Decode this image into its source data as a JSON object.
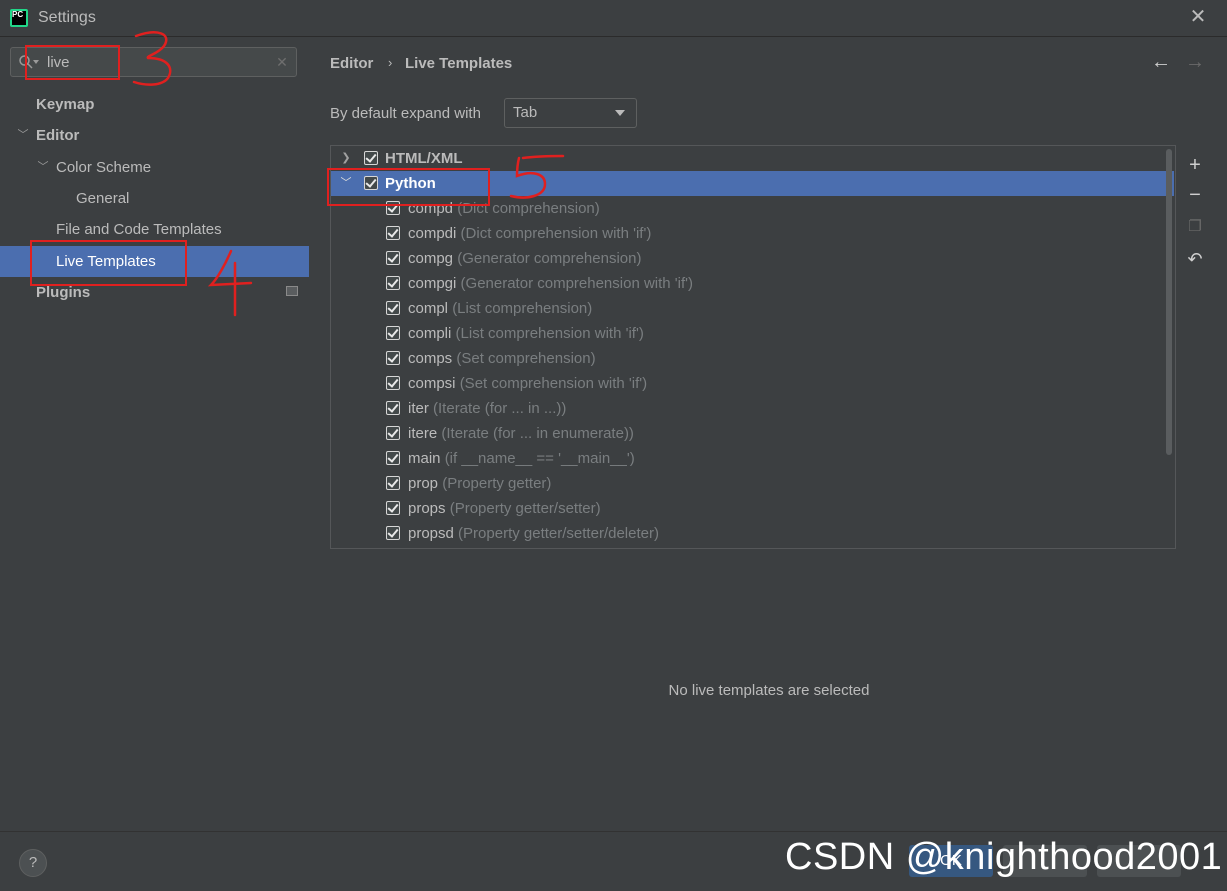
{
  "window": {
    "title": "Settings",
    "app_icon": "pycharm-icon",
    "app_icon_text": "PC"
  },
  "search": {
    "value": "live",
    "placeholder": ""
  },
  "sidebar": {
    "items": [
      {
        "label": "Keymap"
      },
      {
        "label": "Editor"
      },
      {
        "label": "Color Scheme"
      },
      {
        "label": "General"
      },
      {
        "label": "File and Code Templates"
      },
      {
        "label": "Live Templates"
      },
      {
        "label": "Plugins"
      }
    ],
    "selected": "Live Templates"
  },
  "breadcrumb": {
    "parent": "Editor",
    "separator": "›",
    "current": "Live Templates"
  },
  "expand": {
    "label": "By default expand with",
    "value": "Tab"
  },
  "groups": [
    {
      "name": "HTML/XML",
      "expanded": false,
      "checked": true
    },
    {
      "name": "Python",
      "expanded": true,
      "checked": true,
      "selected": true
    }
  ],
  "templates": [
    {
      "abbr": "compd",
      "desc": "(Dict comprehension)"
    },
    {
      "abbr": "compdi",
      "desc": "(Dict comprehension with 'if')"
    },
    {
      "abbr": "compg",
      "desc": "(Generator comprehension)"
    },
    {
      "abbr": "compgi",
      "desc": "(Generator comprehension with 'if')"
    },
    {
      "abbr": "compl",
      "desc": "(List comprehension)"
    },
    {
      "abbr": "compli",
      "desc": "(List comprehension with 'if')"
    },
    {
      "abbr": "comps",
      "desc": "(Set comprehension)"
    },
    {
      "abbr": "compsi",
      "desc": "(Set comprehension with 'if')"
    },
    {
      "abbr": "iter",
      "desc": "(Iterate (for ... in ...))"
    },
    {
      "abbr": "itere",
      "desc": "(Iterate (for ... in enumerate))"
    },
    {
      "abbr": "main",
      "desc": "(if __name__ == '__main__')"
    },
    {
      "abbr": "prop",
      "desc": "(Property getter)"
    },
    {
      "abbr": "props",
      "desc": "(Property getter/setter)"
    },
    {
      "abbr": "propsd",
      "desc": "(Property getter/setter/deleter)"
    }
  ],
  "tools": [
    "plus-icon",
    "minus-icon",
    "copy-icon",
    "undo-icon"
  ],
  "empty_message": "No live templates are selected",
  "buttons": {
    "help": "?",
    "ok": "OK"
  },
  "watermark": "CSDN @knighthood2001",
  "annotations": [
    "3",
    "4",
    "5"
  ],
  "colors": {
    "background": "#3c3f41",
    "selection": "#4b6eaf",
    "annotation": "#e0201f",
    "text": "#bbbbbb",
    "muted": "#7a7e80"
  }
}
